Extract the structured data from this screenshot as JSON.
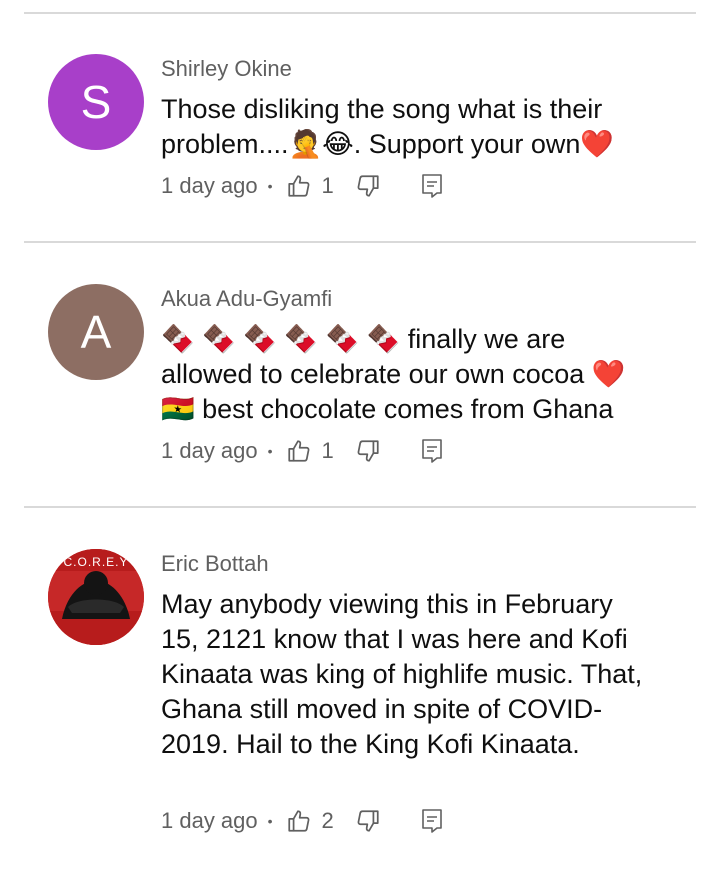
{
  "colors": {
    "avatar_s": "#a83fc9",
    "avatar_a": "#8d6e63",
    "avatar_corey_bg": "#c62828",
    "meta_text": "#606060",
    "divider": "#d9d9d9"
  },
  "comments": [
    {
      "avatar_letter": "S",
      "author": "Shirley Okine",
      "text": "Those disliking the song what is their problem....🤦😂. Support your own❤️",
      "time": "1 day ago",
      "likes": "1"
    },
    {
      "avatar_letter": "A",
      "author": "Akua Adu-Gyamfi",
      "text": "🍫 🍫 🍫 🍫 🍫 🍫 finally we are allowed to celebrate our own cocoa ❤️ 🇬🇭 best chocolate comes from Ghana",
      "time": "1 day ago",
      "likes": "1"
    },
    {
      "avatar_text": "C.O.R.E.Y",
      "author": "Eric Bottah",
      "text": "May anybody viewing this in February 15, 2121 know that I was here and Kofi Kinaata was king of highlife music. That, Ghana still moved in spite of COVID-2019. Hail to the King Kofi Kinaata.",
      "time": "1 day ago",
      "likes": "2"
    }
  ],
  "meta_separator": "•",
  "icons": {
    "like": "thumbs-up-icon",
    "dislike": "thumbs-down-icon",
    "reply": "reply-comment-icon"
  }
}
